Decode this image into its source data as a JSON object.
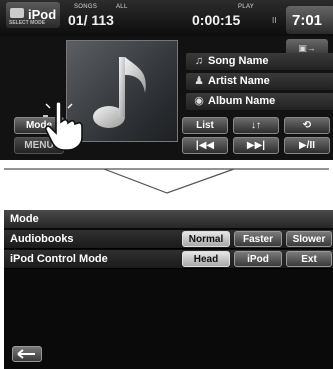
{
  "player": {
    "source_logo": "iPod",
    "source_logo_sub": "SELECT MODE",
    "songs_label": "SONGS",
    "repeat_label": "ALL",
    "track_counter": "01/ 113",
    "play_label": "PLAY",
    "elapsed_time": "0:00:15",
    "pause_indicator": "II",
    "clock": "7:01",
    "song_name": "Song Name",
    "artist_name": "Artist Name",
    "album_name": "Album Name",
    "mode_button": "Mode",
    "menu_button": "MENU",
    "list_button": "List",
    "shuffle_button": "↓↑",
    "prev_button": "|◀◀",
    "next_button": "▶▶|",
    "playpause_button": "▶/II",
    "icons": [
      "music-note-icon",
      "artist-icon",
      "album-disc-icon",
      "repeat-icon",
      "source-switch-icon",
      "hand-pointer-icon"
    ]
  },
  "mode_screen": {
    "title": "Mode",
    "rows": [
      {
        "label": "Audiobooks",
        "options": [
          "Normal",
          "Faster",
          "Slower"
        ],
        "selected": "Normal"
      },
      {
        "label": "iPod Control Mode",
        "options": [
          "Head",
          "iPod",
          "Ext"
        ],
        "selected": "Head"
      }
    ],
    "back_icon": "return-arrow-icon"
  }
}
